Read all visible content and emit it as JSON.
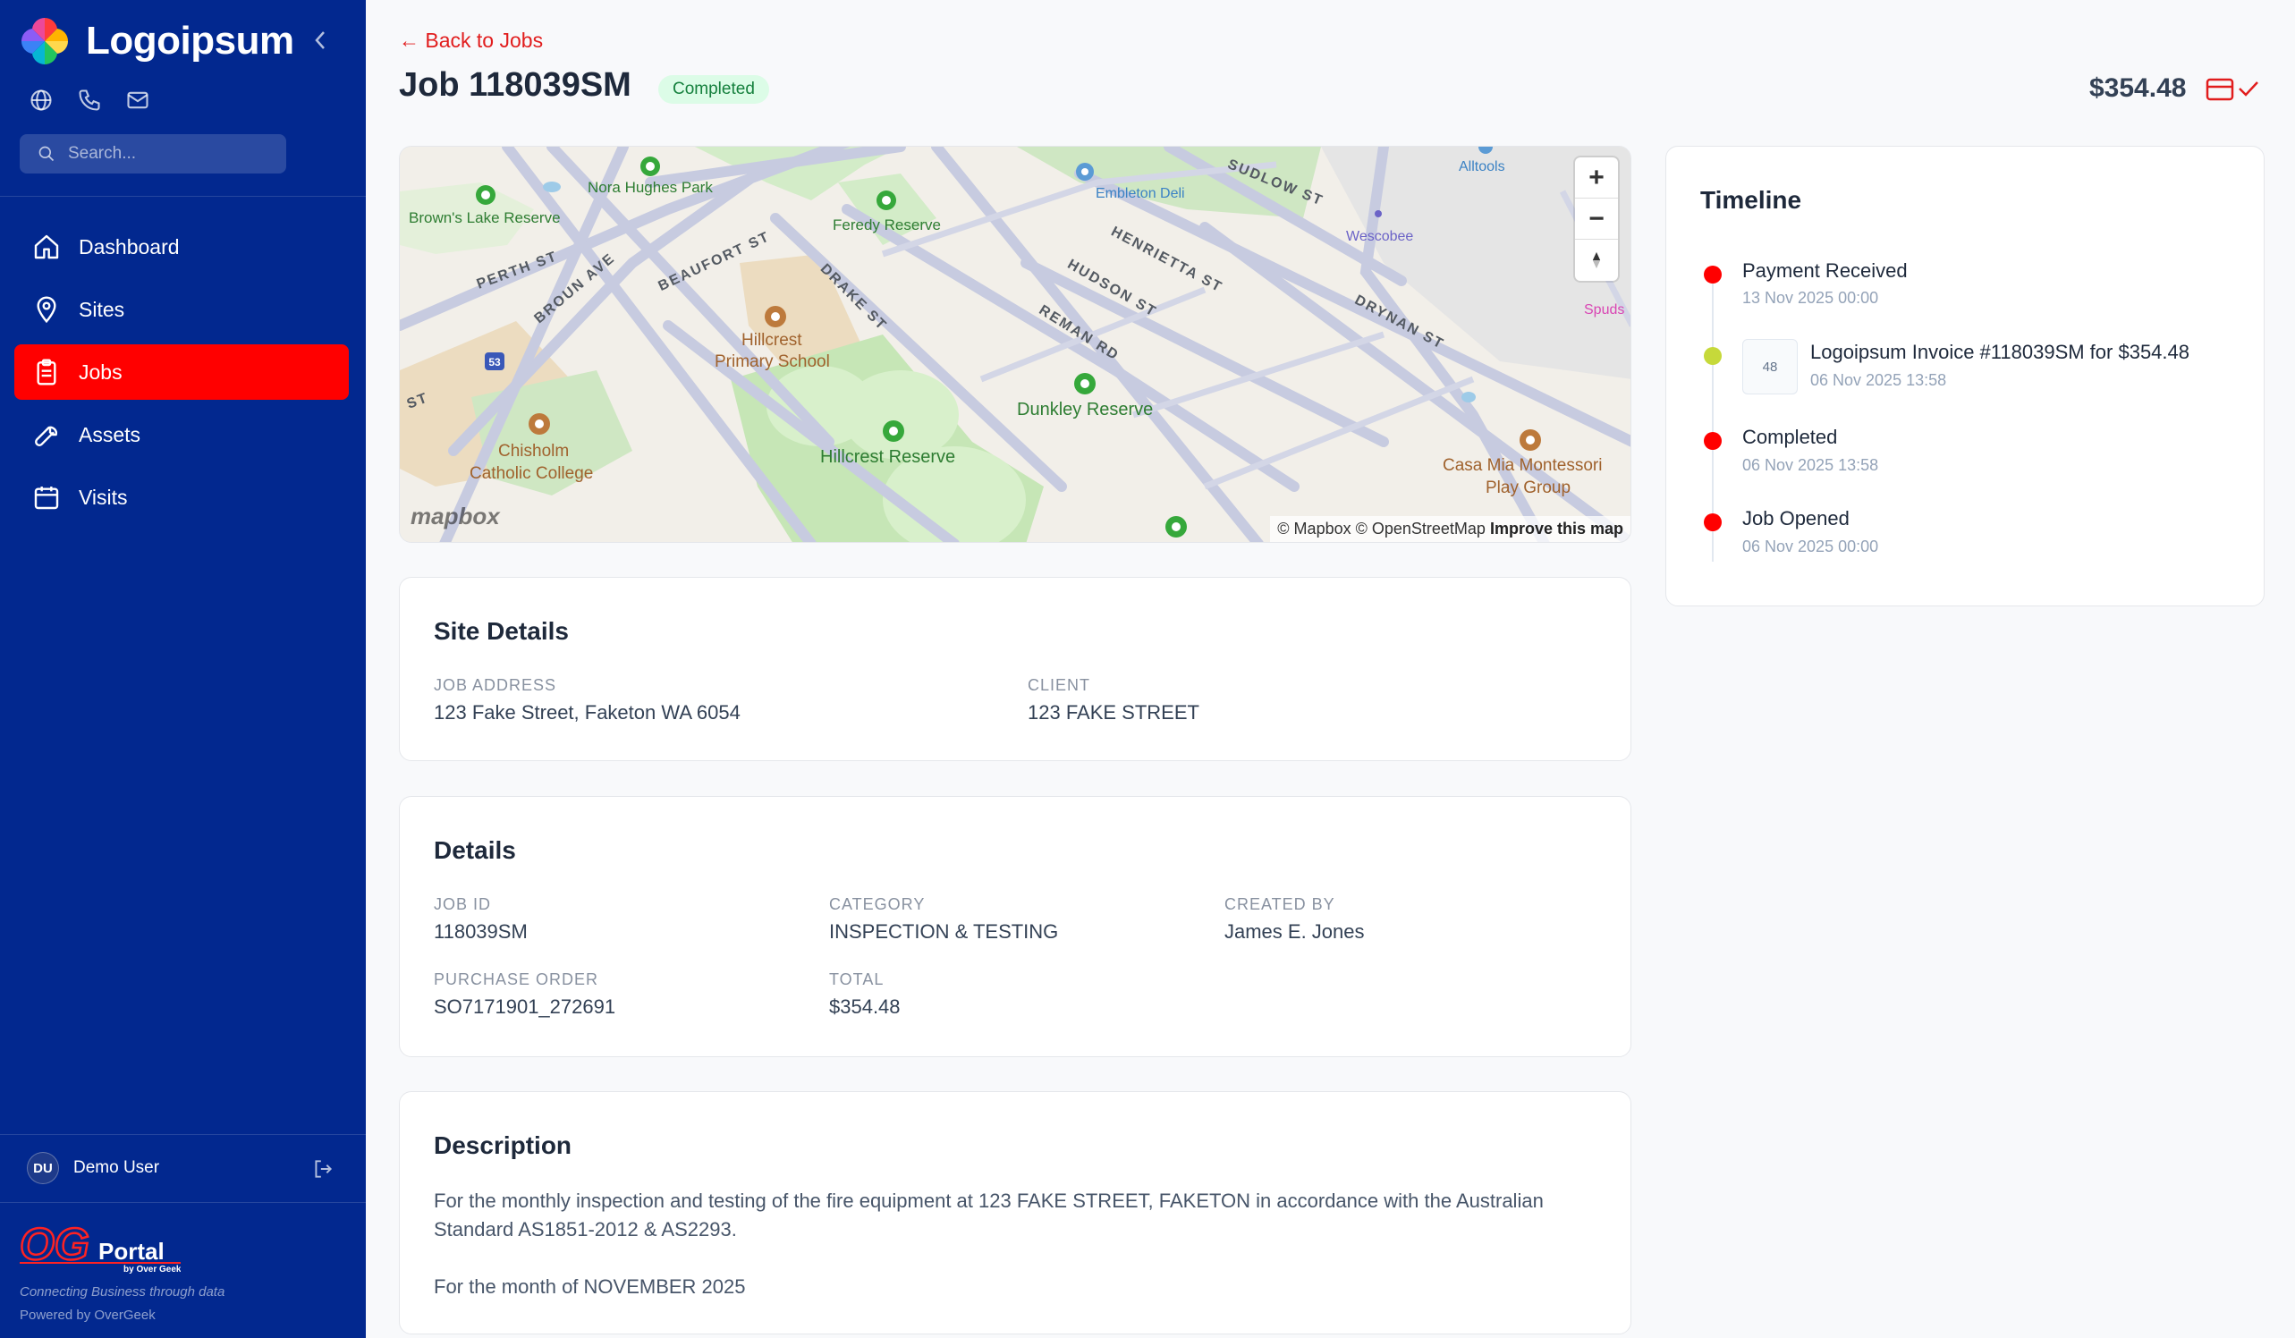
{
  "sidebar": {
    "brand": "Logoipsum",
    "search_placeholder": "Search...",
    "nav": [
      {
        "label": "Dashboard"
      },
      {
        "label": "Sites"
      },
      {
        "label": "Jobs"
      },
      {
        "label": "Assets"
      },
      {
        "label": "Visits"
      }
    ],
    "user": {
      "initials": "DU",
      "name": "Demo User"
    },
    "footer": {
      "logo_text": "OG Portal by Over Geek",
      "tagline": "Connecting Business through data",
      "powered": "Powered by OverGeek"
    },
    "active_color": "#ff0000",
    "background_color": "#02288f"
  },
  "header": {
    "back_label": "← Back to Jobs",
    "title": "Job 118039SM",
    "status": "Completed",
    "price": "$354.48"
  },
  "map": {
    "labels": {
      "brownslake": "Brown's Lake Reserve",
      "norahughes": "Nora Hughes Park",
      "feredy": "Feredy Reserve",
      "embleton": "Embleton Deli",
      "alltools": "Alltools",
      "wescobee": "Wescobee",
      "spuds": "Spuds",
      "hillcrest_school_1": "Hillcrest",
      "hillcrest_school_2": "Primary School",
      "chisholm_1": "Chisholm",
      "chisholm_2": "Catholic College",
      "hillcrest_reserve": "Hillcrest Reserve",
      "dunkley": "Dunkley Reserve",
      "casamia_1": "Casa Mia Montessori",
      "casamia_2": "Play Group",
      "perth": "PERTH ST",
      "broun": "BROUN AVE",
      "beaufort": "BEAUFORT ST",
      "drake": "DRAKE ST",
      "henrietta": "HENRIETTA ST",
      "hudson": "HUDSON ST",
      "reman": "REMAN RD",
      "sudlow": "SUDLOW ST",
      "drynan": "DRYNAN ST",
      "st": "ST",
      "route": "53"
    },
    "mapbox_logo": "mapbox",
    "attribution": "© Mapbox © OpenStreetMap",
    "improve": "Improve this map"
  },
  "site_details": {
    "heading": "Site Details",
    "job_address_label": "JOB ADDRESS",
    "job_address": "123 Fake Street, Faketon WA 6054",
    "client_label": "CLIENT",
    "client": "123 FAKE STREET"
  },
  "details": {
    "heading": "Details",
    "job_id_label": "JOB ID",
    "job_id": "118039SM",
    "category_label": "CATEGORY",
    "category": "INSPECTION & TESTING",
    "created_by_label": "CREATED BY",
    "created_by": "James E. Jones",
    "po_label": "PURCHASE ORDER",
    "po": "SO7171901_272691",
    "total_label": "TOTAL",
    "total": "$354.48"
  },
  "description": {
    "heading": "Description",
    "line1": "For the monthly inspection and testing of the fire equipment at 123 FAKE STREET, FAKETON in accordance with the Australian Standard AS1851-2012 & AS2293.",
    "line2": "For the month of NOVEMBER 2025"
  },
  "timeline": {
    "heading": "Timeline",
    "items": [
      {
        "title": "Payment Received",
        "date": "13 Nov 2025 00:00",
        "color": "#ff0000"
      },
      {
        "title": "Logoipsum Invoice #118039SM for $354.48",
        "date": "06 Nov 2025 13:58",
        "color": "#c6d93a",
        "thumb": "48"
      },
      {
        "title": "Completed",
        "date": "06 Nov 2025 13:58",
        "color": "#ff0000"
      },
      {
        "title": "Job Opened",
        "date": "06 Nov 2025 00:00",
        "color": "#ff0000"
      }
    ]
  }
}
